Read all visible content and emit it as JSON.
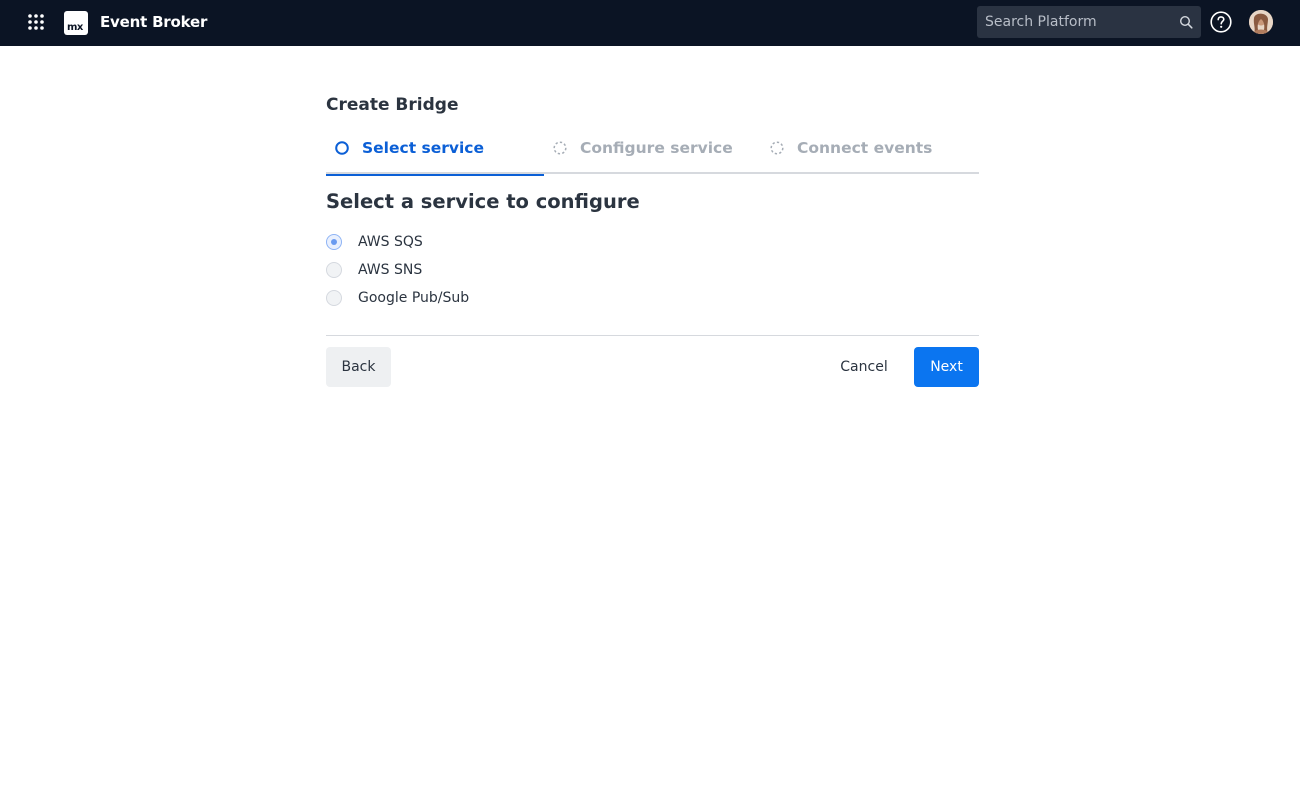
{
  "header": {
    "app_title": "Event Broker",
    "logo_text": "mx",
    "search_placeholder": "Search Platform",
    "icons": {
      "apps": "grid-dots-icon",
      "search": "search-icon",
      "help": "help-circle-icon"
    }
  },
  "page": {
    "title": "Create Bridge"
  },
  "stepper": {
    "steps": [
      {
        "label": "Select service",
        "state": "active"
      },
      {
        "label": "Configure service",
        "state": "pending"
      },
      {
        "label": "Connect events",
        "state": "pending"
      }
    ]
  },
  "section": {
    "title": "Select a service to configure",
    "options": [
      {
        "label": "AWS SQS",
        "selected": true
      },
      {
        "label": "AWS SNS",
        "selected": false
      },
      {
        "label": "Google Pub/Sub",
        "selected": false
      }
    ]
  },
  "footer": {
    "back_label": "Back",
    "cancel_label": "Cancel",
    "next_label": "Next"
  },
  "colors": {
    "topbar": "#0b1424",
    "accent": "#0b5fd6",
    "primary_button": "#0b75f0"
  }
}
